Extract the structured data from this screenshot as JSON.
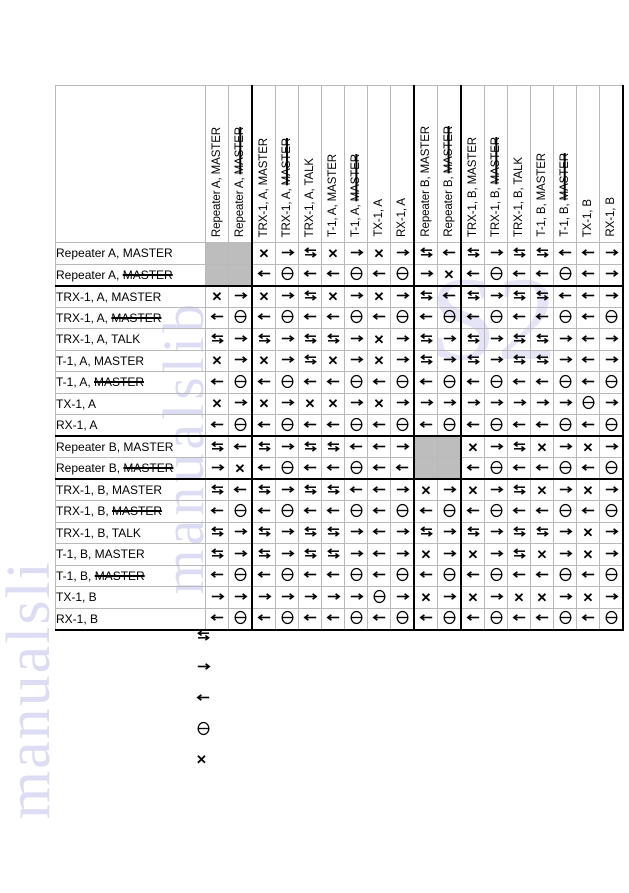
{
  "legend": {
    "items": [
      {
        "symbol": "bidirectional",
        "label": ""
      },
      {
        "symbol": "right",
        "label": ""
      },
      {
        "symbol": "left",
        "label": ""
      },
      {
        "symbol": "circle-bar",
        "label": ""
      },
      {
        "symbol": "x",
        "label": ""
      }
    ]
  },
  "watermarks": {
    "left": "manualsli",
    "middle": "manualslib",
    "right": "S2"
  },
  "chart_data": {
    "type": "table",
    "title": "",
    "columns": [
      {
        "label": "Repeater A, MASTER",
        "struck": false
      },
      {
        "label": "Repeater A, MASTER",
        "struck": true
      },
      {
        "label": "TRX-1, A, MASTER",
        "struck": false
      },
      {
        "label": "TRX-1, A, MASTER",
        "struck": true
      },
      {
        "label": "TRX-1, A, TALK",
        "struck": false
      },
      {
        "label": "T-1, A, MASTER",
        "struck": false
      },
      {
        "label": "T-1, A, MASTER",
        "struck": true
      },
      {
        "label": "TX-1, A",
        "struck": false
      },
      {
        "label": "RX-1, A",
        "struck": false
      },
      {
        "label": "Repeater B, MASTER",
        "struck": false
      },
      {
        "label": "Repeater B, MASTER",
        "struck": true
      },
      {
        "label": "TRX-1, B, MASTER",
        "struck": false
      },
      {
        "label": "TRX-1, B, MASTER",
        "struck": true
      },
      {
        "label": "TRX-1, B, TALK",
        "struck": false
      },
      {
        "label": "T-1, B, MASTER",
        "struck": false
      },
      {
        "label": "T-1, B, MASTER",
        "struck": true
      },
      {
        "label": "TX-1, B",
        "struck": false
      },
      {
        "label": "RX-1, B",
        "struck": false
      }
    ],
    "rows": [
      {
        "label": "Repeater A, MASTER",
        "struck": false,
        "cells": [
          "shade",
          "shade",
          "x",
          "right",
          "bi",
          "x",
          "right",
          "x",
          "right",
          "bi",
          "left",
          "bi",
          "right",
          "bi",
          "bi",
          "left",
          "left",
          "right"
        ]
      },
      {
        "label": "Repeater A, MASTER",
        "struck": true,
        "cells": [
          "shade",
          "shade",
          "left",
          "circ",
          "left",
          "left",
          "circ",
          "left",
          "circ",
          "right",
          "x",
          "left",
          "circ",
          "left",
          "left",
          "circ",
          "left",
          "right"
        ]
      },
      {
        "label": "TRX-1, A, MASTER",
        "struck": false,
        "cells": [
          "x",
          "right",
          "x",
          "right",
          "bi",
          "x",
          "right",
          "x",
          "right",
          "bi",
          "left",
          "bi",
          "right",
          "bi",
          "bi",
          "left",
          "left",
          "right"
        ]
      },
      {
        "label": "TRX-1, A, MASTER",
        "struck": true,
        "cells": [
          "left",
          "circ",
          "left",
          "circ",
          "left",
          "left",
          "circ",
          "left",
          "circ",
          "left",
          "circ",
          "left",
          "circ",
          "left",
          "left",
          "circ",
          "left",
          "circ"
        ]
      },
      {
        "label": "TRX-1, A, TALK",
        "struck": false,
        "cells": [
          "bi",
          "right",
          "bi",
          "right",
          "bi",
          "bi",
          "right",
          "x",
          "right",
          "bi",
          "right",
          "bi",
          "right",
          "bi",
          "bi",
          "right",
          "left",
          "right"
        ]
      },
      {
        "label": "T-1, A, MASTER",
        "struck": false,
        "cells": [
          "x",
          "right",
          "x",
          "right",
          "bi",
          "x",
          "right",
          "x",
          "right",
          "bi",
          "right",
          "bi",
          "right",
          "bi",
          "bi",
          "right",
          "left",
          "right"
        ]
      },
      {
        "label": "T-1, A, MASTER",
        "struck": true,
        "cells": [
          "left",
          "circ",
          "left",
          "circ",
          "left",
          "left",
          "circ",
          "left",
          "circ",
          "left",
          "circ",
          "left",
          "circ",
          "left",
          "left",
          "circ",
          "left",
          "circ"
        ]
      },
      {
        "label": "TX-1, A",
        "struck": false,
        "cells": [
          "x",
          "right",
          "x",
          "right",
          "x",
          "x",
          "right",
          "x",
          "right",
          "right",
          "right",
          "right",
          "right",
          "right",
          "right",
          "right",
          "circ",
          "right"
        ]
      },
      {
        "label": "RX-1, A",
        "struck": false,
        "cells": [
          "left",
          "circ",
          "left",
          "circ",
          "left",
          "left",
          "circ",
          "left",
          "circ",
          "left",
          "circ",
          "left",
          "circ",
          "left",
          "left",
          "circ",
          "left",
          "circ"
        ]
      },
      {
        "label": "Repeater B, MASTER",
        "struck": false,
        "cells": [
          "bi",
          "left",
          "bi",
          "right",
          "bi",
          "bi",
          "left",
          "left",
          "right",
          "shade",
          "shade",
          "x",
          "right",
          "bi",
          "x",
          "right",
          "x",
          "right"
        ]
      },
      {
        "label": "Repeater B, MASTER",
        "struck": true,
        "cells": [
          "right",
          "x",
          "left",
          "circ",
          "left",
          "left",
          "circ",
          "left",
          "left",
          "shade",
          "shade",
          "left",
          "circ",
          "left",
          "left",
          "circ",
          "left",
          "circ"
        ]
      },
      {
        "label": "TRX-1, B, MASTER",
        "struck": false,
        "cells": [
          "bi",
          "left",
          "bi",
          "right",
          "bi",
          "bi",
          "left",
          "left",
          "right",
          "x",
          "right",
          "x",
          "right",
          "bi",
          "x",
          "right",
          "x",
          "right"
        ]
      },
      {
        "label": "TRX-1, B, MASTER",
        "struck": true,
        "cells": [
          "left",
          "circ",
          "left",
          "circ",
          "left",
          "left",
          "circ",
          "left",
          "circ",
          "left",
          "circ",
          "left",
          "circ",
          "left",
          "left",
          "circ",
          "left",
          "circ"
        ]
      },
      {
        "label": "TRX-1, B, TALK",
        "struck": false,
        "cells": [
          "bi",
          "right",
          "bi",
          "right",
          "bi",
          "bi",
          "right",
          "left",
          "right",
          "bi",
          "right",
          "bi",
          "right",
          "bi",
          "bi",
          "right",
          "x",
          "right"
        ]
      },
      {
        "label": "T-1, B, MASTER",
        "struck": false,
        "cells": [
          "bi",
          "right",
          "bi",
          "right",
          "bi",
          "bi",
          "right",
          "left",
          "right",
          "x",
          "right",
          "x",
          "right",
          "bi",
          "x",
          "right",
          "x",
          "right"
        ]
      },
      {
        "label": "T-1, B, MASTER",
        "struck": true,
        "cells": [
          "left",
          "circ",
          "left",
          "circ",
          "left",
          "left",
          "circ",
          "left",
          "circ",
          "left",
          "circ",
          "left",
          "circ",
          "left",
          "left",
          "circ",
          "left",
          "circ"
        ]
      },
      {
        "label": "TX-1, B",
        "struck": false,
        "cells": [
          "right",
          "right",
          "right",
          "right",
          "right",
          "right",
          "right",
          "circ",
          "right",
          "x",
          "right",
          "x",
          "right",
          "x",
          "x",
          "right",
          "x",
          "right"
        ]
      },
      {
        "label": "RX-1, B",
        "struck": false,
        "cells": [
          "left",
          "circ",
          "left",
          "circ",
          "left",
          "left",
          "circ",
          "left",
          "circ",
          "left",
          "circ",
          "left",
          "circ",
          "left",
          "left",
          "circ",
          "left",
          "circ"
        ]
      }
    ],
    "symbol_key": {
      "bi": "bidirectional",
      "right": "right-arrow",
      "left": "left-arrow",
      "circ": "circle-bar",
      "x": "cross",
      "shade": "shaded-blank"
    }
  }
}
